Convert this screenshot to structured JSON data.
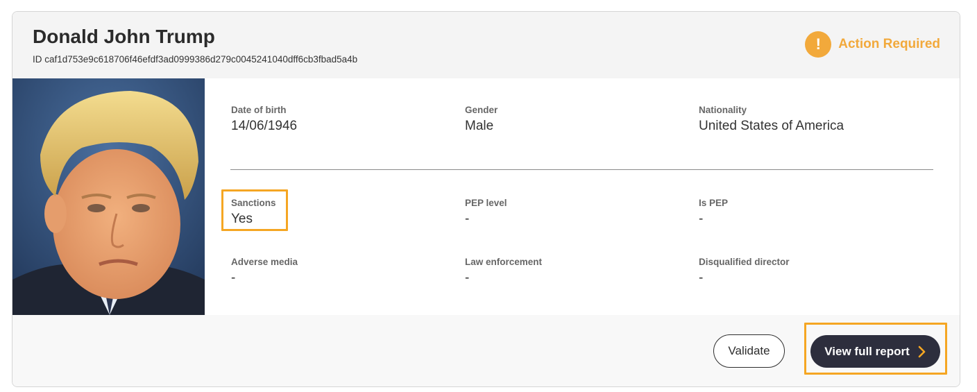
{
  "header": {
    "name": "Donald John Trump",
    "id_text": "ID caf1d753e9c618706f46efdf3ad0999386d279c0045241040dff6cb3fbad5a4b",
    "status_label": "Action Required",
    "status_icon": "exclamation-icon",
    "status_glyph": "!",
    "status_color": "#f2a93b"
  },
  "photo": {
    "alt": "Donald John Trump"
  },
  "details": {
    "date_of_birth": {
      "label": "Date of birth",
      "value": "14/06/1946"
    },
    "gender": {
      "label": "Gender",
      "value": "Male"
    },
    "nationality": {
      "label": "Nationality",
      "value": "United States of America"
    },
    "sanctions": {
      "label": "Sanctions",
      "value": "Yes"
    },
    "pep_level": {
      "label": "PEP level",
      "value": "-"
    },
    "is_pep": {
      "label": "Is PEP",
      "value": "-"
    },
    "adverse_media": {
      "label": "Adverse media",
      "value": "-"
    },
    "law_enforcement": {
      "label": "Law enforcement",
      "value": "-"
    },
    "disqualified_director": {
      "label": "Disqualified director",
      "value": "-"
    }
  },
  "footer": {
    "validate_label": "Validate",
    "report_label": "View full report",
    "report_icon": "chevron-right-icon",
    "accent_color": "#f5a623"
  }
}
